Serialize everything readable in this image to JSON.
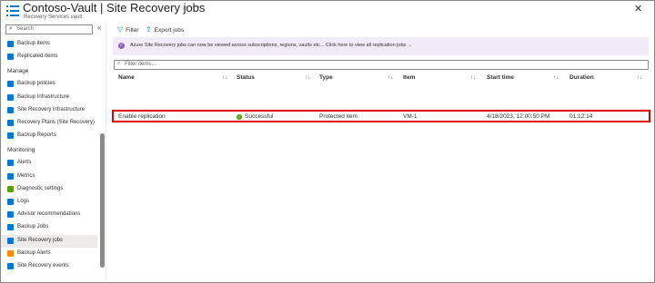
{
  "header": {
    "vault_name": "Contoso-Vault",
    "separator": " | ",
    "page_title": "Site Recovery jobs",
    "subtitle": "Recovery Services vault",
    "pin_glyph": "☆",
    "more_glyph": "···",
    "close_glyph": "✕"
  },
  "sidebar": {
    "search_placeholder": "Search",
    "collapse_glyph": "«",
    "items_top": [
      {
        "label": "Backup items",
        "icon": "backup-items-icon",
        "color": "#0078d4"
      },
      {
        "label": "Replicated items",
        "icon": "replicated-items-icon",
        "color": "#0078d4"
      }
    ],
    "sections": [
      {
        "title": "Manage",
        "items": [
          {
            "label": "Backup policies",
            "icon": "backup-policies-icon",
            "color": "#0078d4"
          },
          {
            "label": "Backup Infrastructure",
            "icon": "backup-infrastructure-icon",
            "color": "#0078d4"
          },
          {
            "label": "Site Recovery infrastructure",
            "icon": "site-recovery-infrastructure-icon",
            "color": "#0078d4"
          },
          {
            "label": "Recovery Plans (Site Recovery)",
            "icon": "recovery-plans-icon",
            "color": "#0078d4"
          },
          {
            "label": "Backup Reports",
            "icon": "backup-reports-icon",
            "color": "#0078d4"
          }
        ]
      },
      {
        "title": "Monitoring",
        "items": [
          {
            "label": "Alerts",
            "icon": "alerts-icon",
            "color": "#0078d4"
          },
          {
            "label": "Metrics",
            "icon": "metrics-icon",
            "color": "#0078d4"
          },
          {
            "label": "Diagnostic settings",
            "icon": "diagnostic-settings-icon",
            "color": "#57a300"
          },
          {
            "label": "Logs",
            "icon": "logs-icon",
            "color": "#0078d4"
          },
          {
            "label": "Advisor recommendations",
            "icon": "advisor-icon",
            "color": "#0078d4"
          },
          {
            "label": "Backup Jobs",
            "icon": "backup-jobs-icon",
            "color": "#0078d4"
          },
          {
            "label": "Site Recovery jobs",
            "icon": "site-recovery-jobs-icon",
            "color": "#0078d4",
            "selected": true
          },
          {
            "label": "Backup Alerts",
            "icon": "backup-alerts-icon",
            "color": "#ff8c00"
          },
          {
            "label": "Site Recovery events",
            "icon": "site-recovery-events-icon",
            "color": "#0078d4"
          }
        ]
      }
    ]
  },
  "toolbar": {
    "filter_label": "Filter",
    "export_label": "Export jobs"
  },
  "banner": {
    "text": "Azure Site Recovery jobs can now be viewed across subscriptions, regions, vaults etc... Click here to view all replication jobs  →"
  },
  "filter": {
    "placeholder": "Filter items..."
  },
  "table": {
    "columns": [
      "Name",
      "Status",
      "Type",
      "Item",
      "Start time",
      "Duration"
    ],
    "rows": [
      {
        "name": "Enable replication",
        "status": "Successful",
        "type": "Protected item",
        "item": "VM-1",
        "start_time": "4/18/2023, 12:00:50 PM",
        "duration": "01:12:14"
      }
    ]
  },
  "colors": {
    "accent": "#0078d4",
    "highlight_border": "#e3000b",
    "success": "#57a300",
    "banner_bg": "#f3eaf8"
  }
}
